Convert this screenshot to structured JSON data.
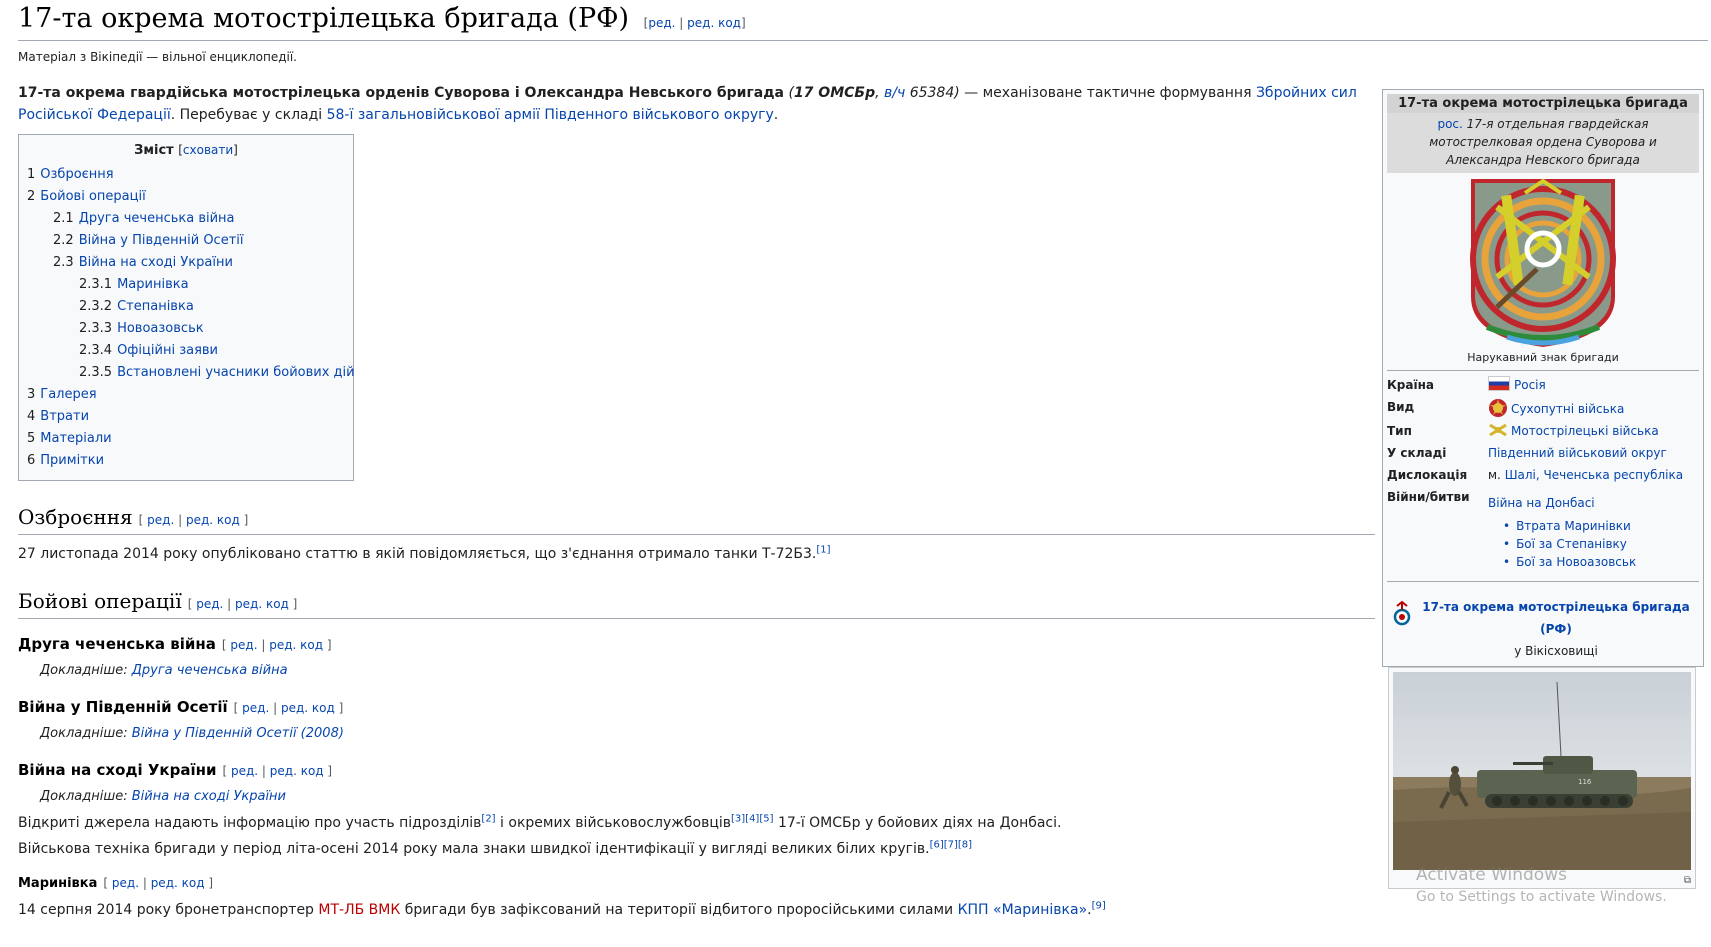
{
  "page": {
    "title": "17-та окрема мотострілецька бригада (РФ)",
    "title_edit": "ред.",
    "title_edit_code": "ред. код",
    "tagline": "Матеріал з Вікіпедії — вільної енциклопедії."
  },
  "intro": {
    "bold_name": "17-та окрема гвардійська мотострілецька орденів Суворова і Олександра Невського бригада",
    "paren_open": " (",
    "abbr": "17 ОМСБр",
    "comma": ", ",
    "unit_link": "в/ч",
    "unit_num": " 65384)",
    "text1": " — механізоване тактичне формування ",
    "link1": "Збройних сил Російської Федерації",
    "text2": ". Перебуває у складі ",
    "link2": "58-ї загальновійськової армії",
    "link3": "Південного військового округу",
    "text3": "."
  },
  "toc": {
    "title": "Зміст",
    "toggle": "сховати",
    "items": [
      {
        "num": "1",
        "label": "Озброєння"
      },
      {
        "num": "2",
        "label": "Бойові операції"
      },
      {
        "num": "2.1",
        "label": "Друга чеченська війна"
      },
      {
        "num": "2.2",
        "label": "Війна у Південній Осетії"
      },
      {
        "num": "2.3",
        "label": "Війна на сході України"
      },
      {
        "num": "2.3.1",
        "label": "Маринівка"
      },
      {
        "num": "2.3.2",
        "label": "Степанівка"
      },
      {
        "num": "2.3.3",
        "label": "Новоазовськ"
      },
      {
        "num": "2.3.4",
        "label": "Офіційні заяви"
      },
      {
        "num": "2.3.5",
        "label": "Встановлені учасники бойових дій"
      },
      {
        "num": "3",
        "label": "Галерея"
      },
      {
        "num": "4",
        "label": "Втрати"
      },
      {
        "num": "5",
        "label": "Матеріали"
      },
      {
        "num": "6",
        "label": "Примітки"
      }
    ]
  },
  "edit_links": {
    "ed": "ред.",
    "ed_code": "ред. код"
  },
  "sections": {
    "armament": {
      "title": "Озброєння",
      "text": "27 листопада 2014 року опубліковано статтю в якій повідомляється, що з'єднання отримало танки Т-72Б3.",
      "ref": "[1]"
    },
    "operations": {
      "title": "Бойові операції"
    },
    "chechen": {
      "title": "Друга чеченська війна",
      "hat_prefix": "Докладніше: ",
      "hat_link": "Друга чеченська війна"
    },
    "ossetia": {
      "title": "Війна у Південній Осетії",
      "hat_prefix": "Докладніше: ",
      "hat_link": "Війна у Південній Осетії (2008)"
    },
    "ukraine": {
      "title": "Війна на сході України",
      "hat_prefix": "Докладніше: ",
      "hat_link": "Війна на сході України",
      "p1a": "Відкриті джерела надають інформацію про участь підрозділів",
      "p1ref1": "[2]",
      "p1b": " і окремих військовослужбовців",
      "p1ref2": "[3][4][5]",
      "p1c": " 17-ї ОМСБр у бойових діях на Донбасі.",
      "p2": "Військова техніка бригади у період літа-осені 2014 року мала знаки швидкої ідентифікації у вигляді великих білих кругів.",
      "p2ref": "[6][7][8]"
    },
    "marinivka": {
      "title": "Маринівка",
      "t1": "14 серпня 2014 року бронетранспортер ",
      "red_link": "МТ-ЛБ ВМК",
      "t2": " бригади був зафіксований на території відбитого проросійськими силами ",
      "link": "КПП «Маринівка»",
      "t3": ".",
      "ref": "[9]"
    }
  },
  "infobox": {
    "header": "17-та окрема мотострілецька бригада",
    "sub_link": "рос.",
    "sub_text": " 17-я отдельная гвардейская мотострелковая ордена Суворова и Александра Невского бригада",
    "caption": "Нарукавний знак бригади",
    "rows": {
      "country_k": "Країна",
      "country_v": "Росія",
      "kind_k": "Вид",
      "kind_v": "Сухопутні війська",
      "type_k": "Тип",
      "type_v": "Мотострілецькі війська",
      "part_k": "У складі",
      "part_v": "Південний військовий округ",
      "loc_k": "Дислокація",
      "loc_prefix": "м. ",
      "loc_v": "Шалі, Чеченська республіка",
      "wars_k": "Війни/битви",
      "wars_v": "Війна на Донбасі"
    },
    "battles": [
      "Втрата Маринівки",
      "Бої за Степанівку",
      "Бої за Новоазовськ"
    ],
    "commons_link": "17-та окрема мотострілецька бригада (РФ)",
    "commons_suffix": "у Вікісховищі"
  },
  "thumb": {
    "vehicle_number": "116"
  },
  "watermark": {
    "line1": "Activate Windows",
    "line2": "Go to Settings to activate Windows."
  }
}
